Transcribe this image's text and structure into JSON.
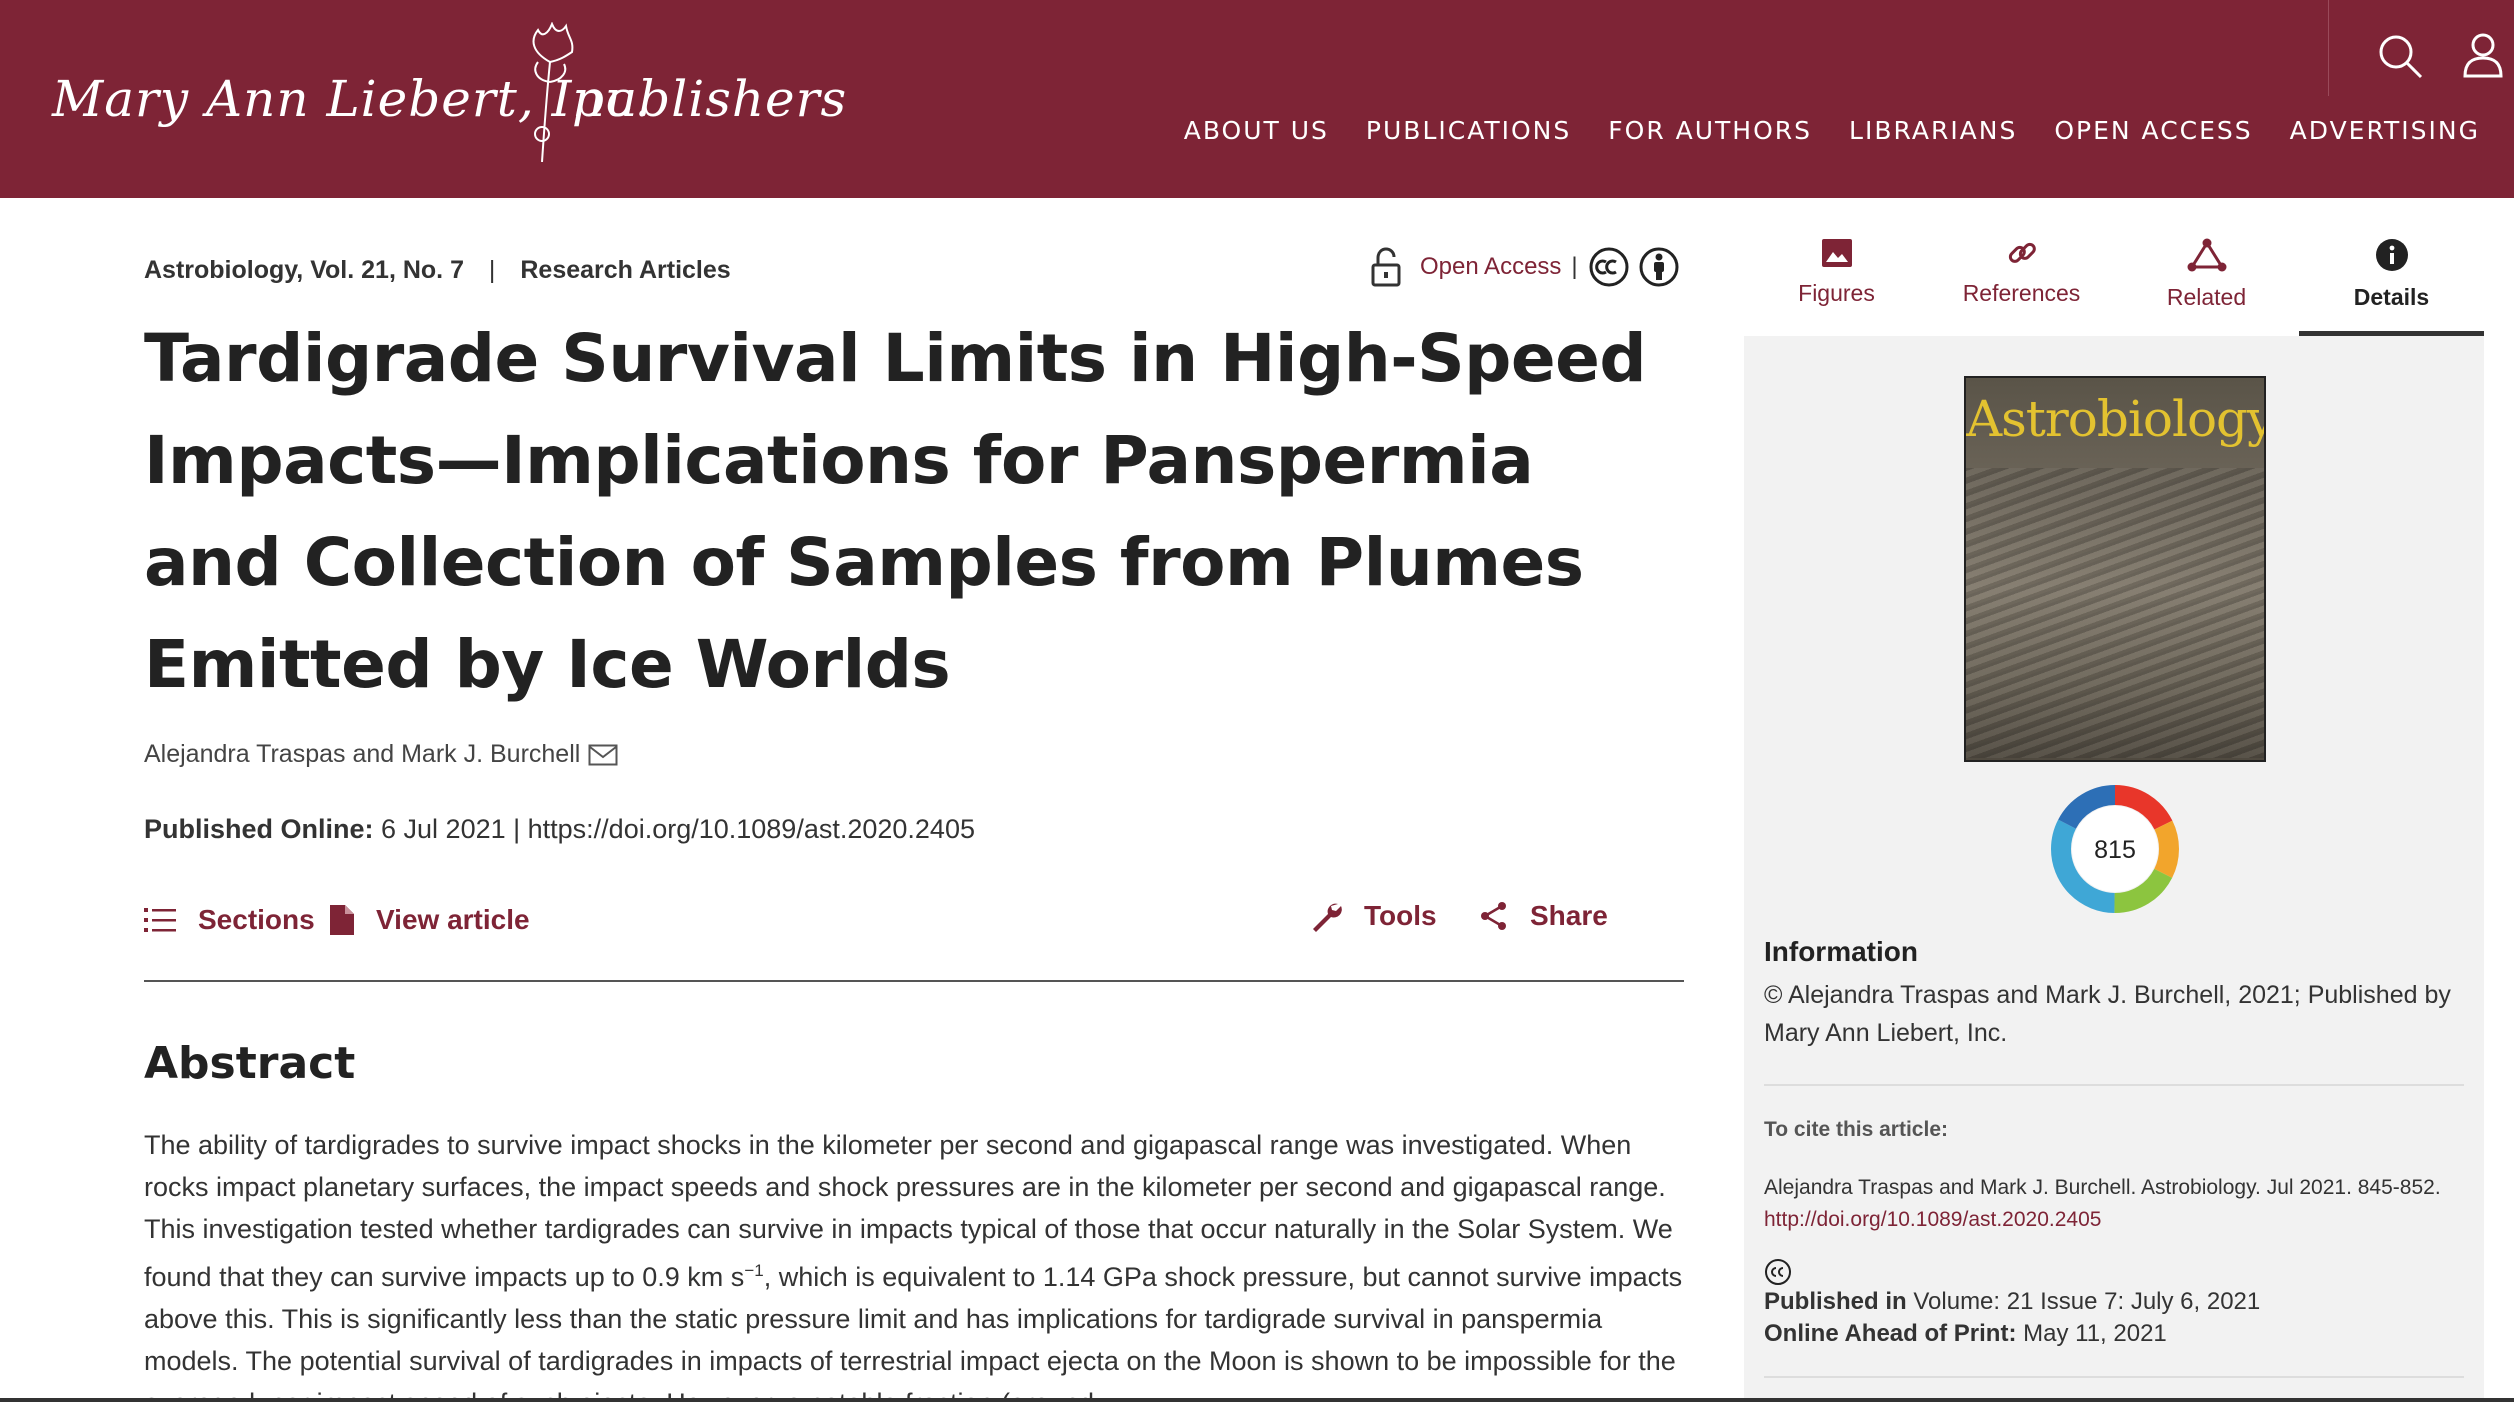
{
  "header": {
    "logo_left": "Mary Ann Liebert, Inc.",
    "logo_right": "publishers",
    "nav": [
      "ABOUT US",
      "PUBLICATIONS",
      "FOR AUTHORS",
      "LIBRARIANS",
      "OPEN ACCESS",
      "ADVERTISING"
    ],
    "icons": [
      "search-icon",
      "user-icon"
    ],
    "brand_color": "#7e2436"
  },
  "article": {
    "journal": "Astrobiology,",
    "volume": "Vol. 21, No. 7",
    "sep": "|",
    "section": "Research Articles",
    "open_access": "Open Access",
    "oa_sep": "|",
    "title": "Tardigrade Survival Limits in High-Speed Impacts—Implications for Panspermia and Collection of Samples from Plumes Emitted by Ice Worlds",
    "authors": "Alejandra Traspas and Mark J. Burchell",
    "published_label": "Published Online:",
    "published_value": " 6 Jul 2021 | https://doi.org/10.1089/ast.2020.2405",
    "actions": {
      "sections": "Sections",
      "view_article": "View article",
      "tools": "Tools",
      "share": "Share"
    },
    "abstract_heading": "Abstract",
    "abstract_before_sup": "The ability of tardigrades to survive impact shocks in the kilometer per second and gigapascal range was investigated. When rocks impact planetary surfaces, the impact speeds and shock pressures are in the kilometer per second and gigapascal range. This investigation tested whether tardigrades can survive in impacts typical of those that occur naturally in the Solar System. We found that they can survive impacts up to 0.9 km s",
    "abstract_sup": "−1",
    "abstract_after_sup": ", which is equivalent to 1.14 GPa shock pressure, but cannot survive impacts above this. This is significantly less than the static pressure limit and has implications for tardigrade survival in panspermia models. The potential survival of tardigrades in impacts of terrestrial impact ejecta on the Moon is shown to be impossible for the average lunar impact speed of such ejecta. However, a notable fraction (around"
  },
  "sidebar": {
    "tabs": [
      {
        "label": "Figures",
        "icon": "image-icon"
      },
      {
        "label": "References",
        "icon": "link-icon"
      },
      {
        "label": "Related",
        "icon": "network-icon"
      },
      {
        "label": "Details",
        "icon": "info-icon"
      }
    ],
    "cover_title": "Astrobiology",
    "altmetric_score": "815",
    "info_heading": "Information",
    "info_text": "© Alejandra Traspas and Mark J. Burchell, 2021; Published by Mary Ann Liebert, Inc.",
    "cite_heading": "To cite this article:",
    "cite_text": "Alejandra Traspas and Mark J. Burchell. Astrobiology. Jul 2021. 845-852. ",
    "cite_link": "http://doi.org/10.1089/ast.2020.2405",
    "published_in_label": "Published in",
    "published_in_value": "  Volume: 21 Issue 7: July 6, 2021",
    "online_ahead_label": "Online Ahead of Print:",
    "online_ahead_value": "  May 11, 2021"
  }
}
